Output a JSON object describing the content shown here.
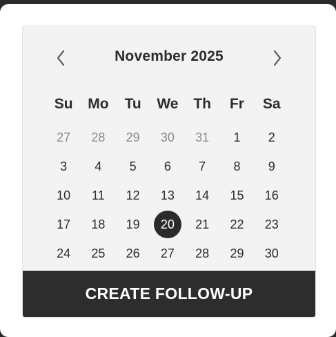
{
  "calendar": {
    "month_label": "November 2025",
    "weekdays": [
      "Su",
      "Mo",
      "Tu",
      "We",
      "Th",
      "Fr",
      "Sa"
    ],
    "weeks": [
      [
        {
          "d": "27",
          "muted": true
        },
        {
          "d": "28",
          "muted": true
        },
        {
          "d": "29",
          "muted": true
        },
        {
          "d": "30",
          "muted": true
        },
        {
          "d": "31",
          "muted": true
        },
        {
          "d": "1"
        },
        {
          "d": "2"
        }
      ],
      [
        {
          "d": "3"
        },
        {
          "d": "4"
        },
        {
          "d": "5"
        },
        {
          "d": "6"
        },
        {
          "d": "7"
        },
        {
          "d": "8"
        },
        {
          "d": "9"
        }
      ],
      [
        {
          "d": "10"
        },
        {
          "d": "11"
        },
        {
          "d": "12"
        },
        {
          "d": "13"
        },
        {
          "d": "14"
        },
        {
          "d": "15"
        },
        {
          "d": "16"
        }
      ],
      [
        {
          "d": "17"
        },
        {
          "d": "18"
        },
        {
          "d": "19"
        },
        {
          "d": "20",
          "selected": true
        },
        {
          "d": "21"
        },
        {
          "d": "22"
        },
        {
          "d": "23"
        }
      ],
      [
        {
          "d": "24"
        },
        {
          "d": "25"
        },
        {
          "d": "26"
        },
        {
          "d": "27"
        },
        {
          "d": "28"
        },
        {
          "d": "29"
        },
        {
          "d": "30"
        }
      ]
    ],
    "prev_icon": "chevron-left-icon",
    "next_icon": "chevron-right-icon"
  },
  "action": {
    "create_label": "CREATE FOLLOW-UP"
  },
  "colors": {
    "selected_bg": "#2b2b2b",
    "button_bg": "#2d2d2d",
    "muted_text": "#8a8a8a"
  }
}
